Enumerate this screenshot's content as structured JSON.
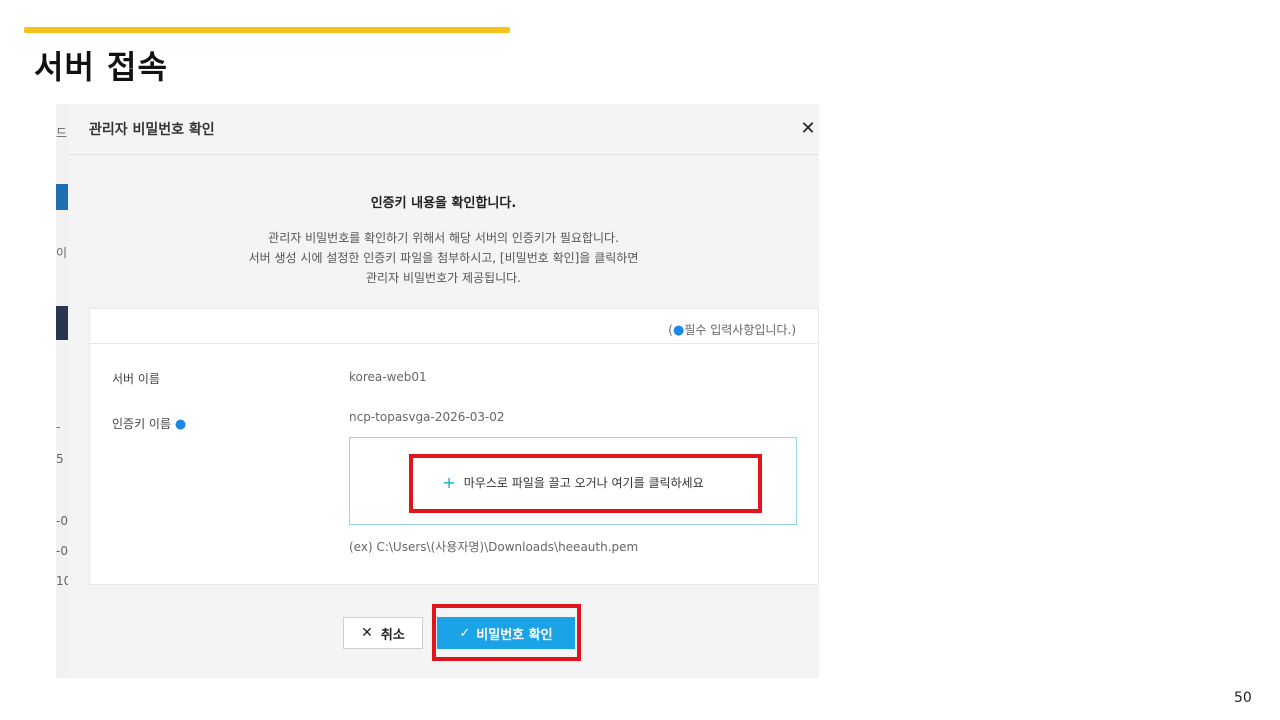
{
  "slide": {
    "title": "서버 접속",
    "page_number": "50",
    "accent_color": "#f7c31a",
    "highlight_color": "#e0141c"
  },
  "background_fragments": [
    "드",
    "이",
    "-",
    "5",
    "-0",
    "-0",
    "10"
  ],
  "modal": {
    "title": "관리자 비밀번호 확인",
    "close_icon": "close-icon",
    "intro": {
      "heading": "인증키 내용을 확인합니다.",
      "lines": [
        "관리자 비밀번호를 확인하기 위해서 해당 서버의 인증키가 필요합니다.",
        "서버 생성 시에 설정한 인증키 파일을 첨부하시고, [비밀번호 확인]을 클릭하면",
        "관리자 비밀번호가 제공됩니다."
      ]
    },
    "form": {
      "required_note": "필수 입력사항입니다.",
      "server_name_label": "서버 이름",
      "server_name_value": "korea-web01",
      "auth_key_label": "인증키 이름",
      "auth_key_value": "ncp-topasvga-2026-03-02",
      "dropzone_text": "마우스로 파일을 끌고 오거나 여기를 클릭하세요",
      "example_path": "(ex) C:\\Users\\(사용자명)\\Downloads\\heeauth.pem"
    },
    "buttons": {
      "cancel_label": "취소",
      "confirm_label": "비밀번호 확인"
    },
    "accent_color": "#1aa3e6"
  }
}
